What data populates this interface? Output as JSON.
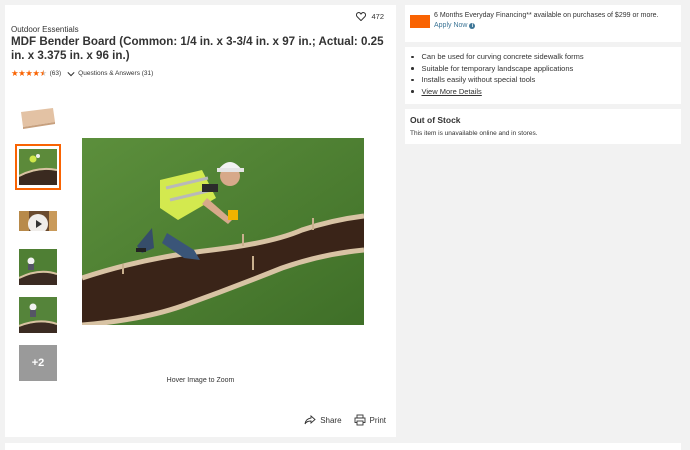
{
  "product": {
    "brand": "Outdoor Essentials",
    "title": "MDF Bender Board (Common: 1/4 in. x 3-3/4 in. x 97 in.; Actual: 0.25 in. x 3.375 in. x 96 in.)",
    "favorites_count": "472",
    "rating": 4.5,
    "review_count": "(63)",
    "qa_label": "Questions & Answers (31)"
  },
  "gallery": {
    "more_label": "+2",
    "hover_hint": "Hover Image to Zoom",
    "share_label": "Share",
    "print_label": "Print"
  },
  "financing": {
    "text": "6 Months Everyday Financing** available on purchases of $299 or more.",
    "link": "Apply Now"
  },
  "features": {
    "items": [
      "Can be used for curving concrete sidewalk forms",
      "Suitable for temporary landscape applications",
      "Installs easily without special tools"
    ],
    "more_link": "View More Details"
  },
  "stock": {
    "title": "Out of Stock",
    "message": "This item is unavailable online and in stores."
  },
  "colors": {
    "accent": "#f96302",
    "link": "#3e7697"
  }
}
